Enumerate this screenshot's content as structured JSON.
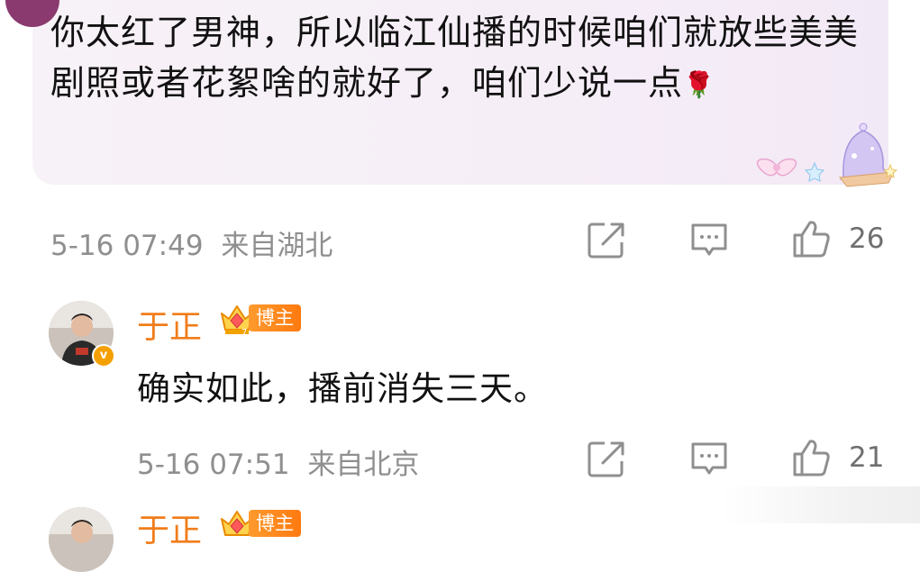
{
  "comment": {
    "text": "你太红了男神，所以临江仙播的时候咱们就放些美美剧照或者花絮啥的就好了，咱们少说一点",
    "emoji": "🌹",
    "time": "5-16 07:49",
    "location": "来自湖北",
    "like_count": "26"
  },
  "reply": {
    "username": "于正",
    "badge": "博主",
    "text": "确实如此，播前消失三天。",
    "time": "5-16 07:51",
    "location": "来自北京",
    "like_count": "21"
  },
  "reply_partial": {
    "username": "于正",
    "badge": "博主"
  },
  "colors": {
    "username": "#f07d1a",
    "meta": "#8f8f8f",
    "bubble": "#f6eef7"
  }
}
